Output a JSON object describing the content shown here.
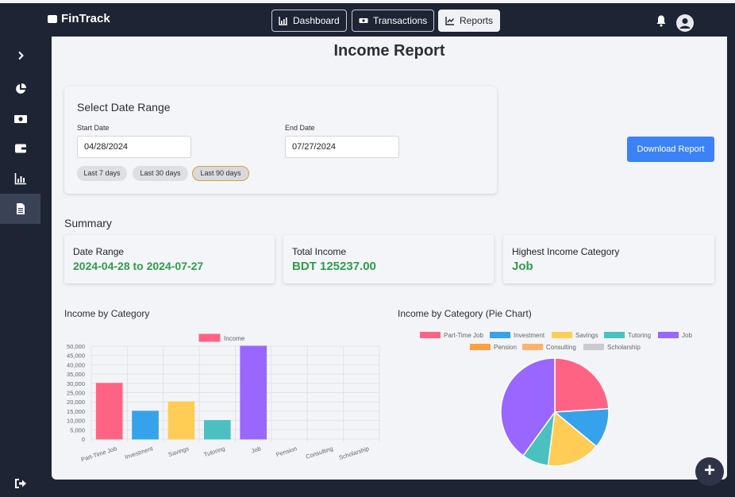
{
  "app": {
    "brand": "FinTrack"
  },
  "nav": [
    {
      "label": "Dashboard",
      "icon": "chart-icon"
    },
    {
      "label": "Transactions",
      "icon": "money-icon"
    },
    {
      "label": "Reports",
      "icon": "trend-icon",
      "active": true
    }
  ],
  "page": {
    "title": "Income Report"
  },
  "date_range": {
    "title": "Select Date Range",
    "start_label": "Start Date",
    "start_value": "04/28/2024",
    "end_label": "End Date",
    "end_value": "07/27/2024",
    "chips": [
      "Last 7 days",
      "Last 30 days",
      "Last 90 days"
    ],
    "active_chip": "Last 90 days"
  },
  "download_button": "Download Report",
  "summary": {
    "title": "Summary",
    "date_range_label": "Date Range",
    "date_range_value": "2024-04-28 to 2024-07-27",
    "total_income_label": "Total Income",
    "total_income_value": "BDT 125237.00",
    "highest_label": "Highest Income Category",
    "highest_value": "Job"
  },
  "charts": {
    "bar_title": "Income by Category",
    "pie_title": "Income by Category (Pie Chart)"
  },
  "colors": {
    "accent": "#3b82f6",
    "positive": "#2f9c4b",
    "navbar": "#1d2433"
  },
  "chart_data": [
    {
      "type": "bar",
      "categories": [
        "Part-Time Job",
        "Investment",
        "Savings",
        "Tutoring",
        "Job",
        "Pension",
        "Consulting",
        "Scholarship"
      ],
      "series": [
        {
          "name": "Income",
          "values": [
            30000,
            15000,
            20000,
            10000,
            50000,
            0,
            0,
            0
          ],
          "color": "#ff6384"
        }
      ],
      "bar_colors": [
        "#ff6384",
        "#36a2eb",
        "#ffcd56",
        "#4bc0c0",
        "#9966ff",
        "#ff9f40",
        "#ffb26b",
        "#c9cbcf"
      ],
      "yticks": [
        "50,000",
        "45,000",
        "40,000",
        "35,000",
        "30,000",
        "25,000",
        "20,000",
        "15,000",
        "10,000",
        "5,000",
        "0"
      ],
      "ylim": [
        0,
        50000
      ],
      "grid": true,
      "legend": "top"
    },
    {
      "type": "pie",
      "labels": [
        "Part-Time Job",
        "Investment",
        "Savings",
        "Tutoring",
        "Job",
        "Pension",
        "Consulting",
        "Scholarship"
      ],
      "values": [
        30000,
        15000,
        20000,
        10000,
        50000,
        0,
        0,
        0
      ],
      "colors": [
        "#ff6384",
        "#36a2eb",
        "#ffcd56",
        "#4bc0c0",
        "#9966ff",
        "#ff9f40",
        "#ffb26b",
        "#c9cbcf"
      ],
      "legend": "top"
    }
  ]
}
